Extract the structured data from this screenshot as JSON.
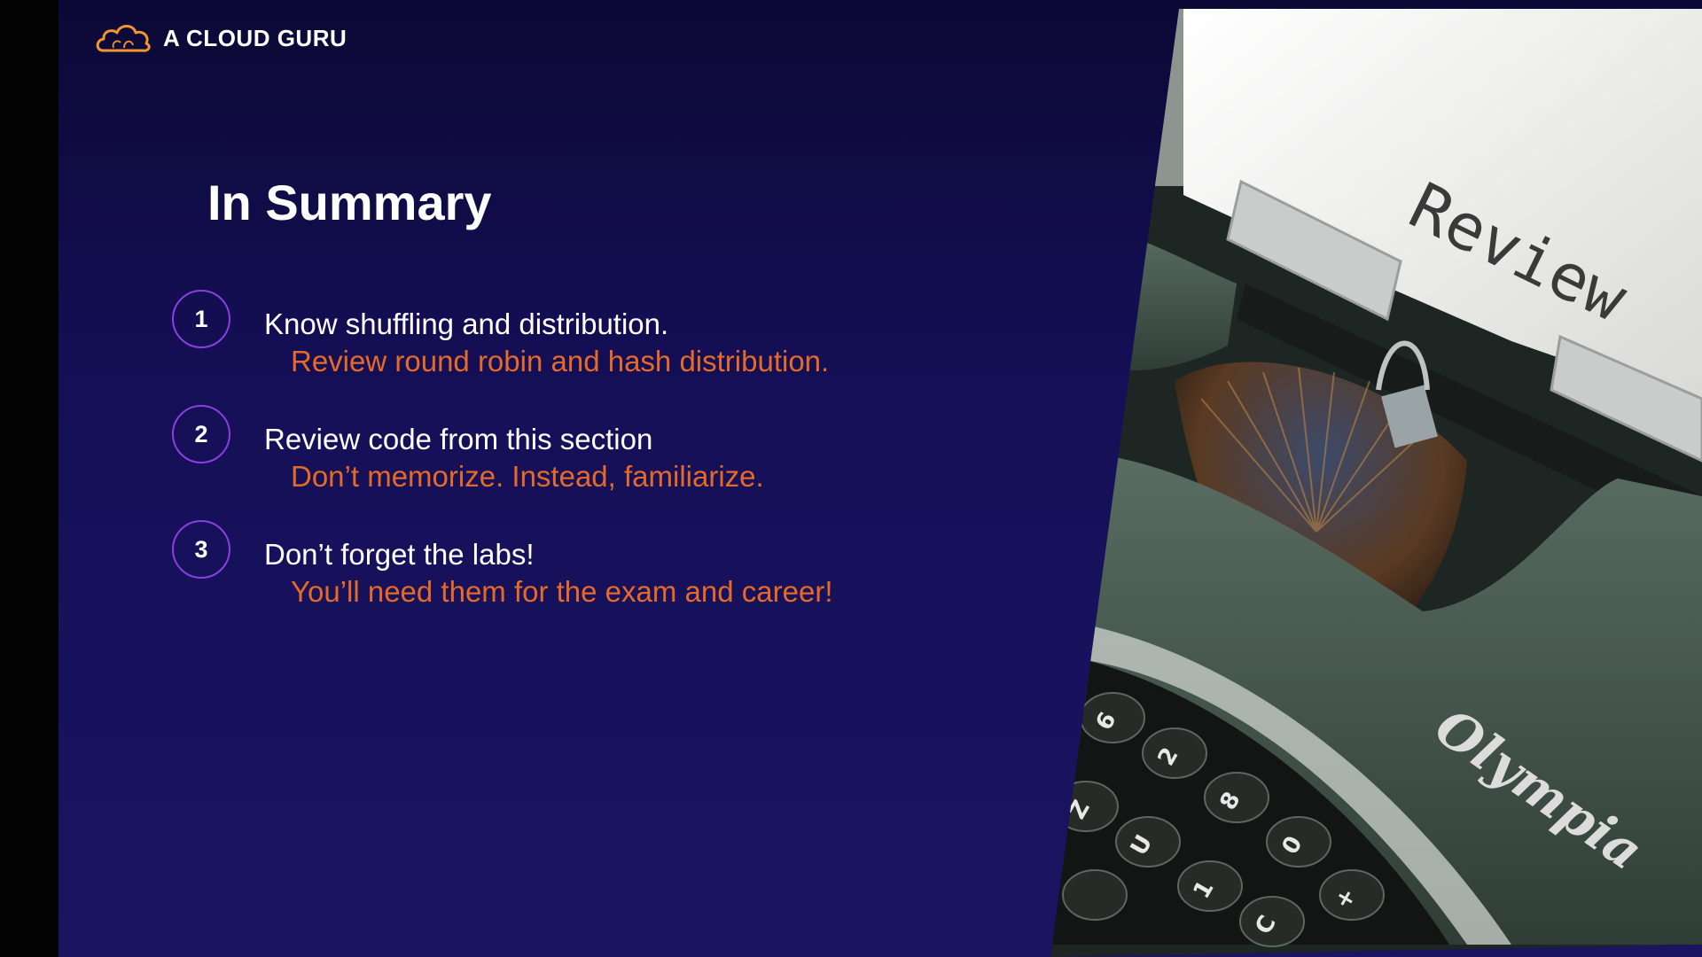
{
  "brand": {
    "name": "A CLOUD GURU",
    "accent": "#f2962e"
  },
  "slide": {
    "title": "In Summary",
    "items": [
      {
        "number": "1",
        "heading": "Know shuffling and distribution.",
        "detail": "Review round robin and hash distribution."
      },
      {
        "number": "2",
        "heading": "Review code from this section",
        "detail": "Don’t memorize. Instead, familiarize."
      },
      {
        "number": "3",
        "heading": "Don’t forget the labs!",
        "detail": "You’ll need them for the exam and career!"
      }
    ]
  },
  "photo": {
    "paper_text": "Review",
    "typewriter_brand": "Olympia",
    "key_labels": [
      "6",
      "2",
      "8",
      "Z",
      "U",
      "0",
      "1",
      "C",
      "+"
    ]
  },
  "colors": {
    "background_top": "#0c0936",
    "background_bottom": "#1a1461",
    "circle_border": "#8b3fe0",
    "detail_text": "#e66a27",
    "heading_text": "#ffffff",
    "typewriter_green": "#46594d"
  }
}
